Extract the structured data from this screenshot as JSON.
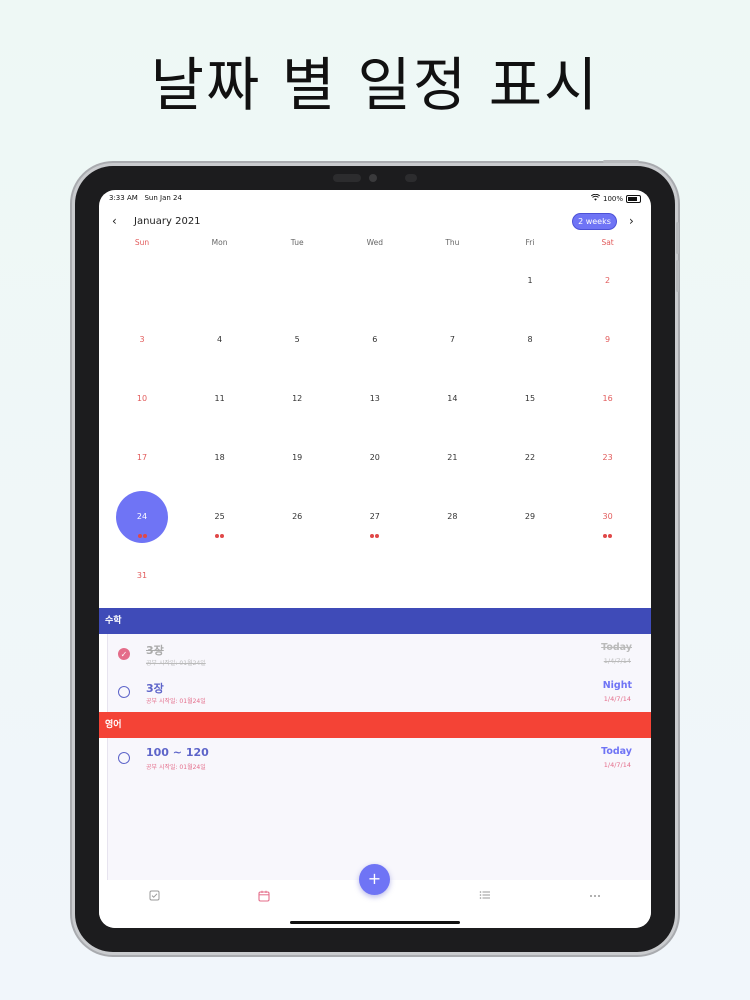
{
  "headline": "날짜 별 일정 표시",
  "status": {
    "time": "3:33 AM",
    "date": "Sun Jan 24",
    "battery": "100%"
  },
  "calendar": {
    "month": "January 2021",
    "view_toggle": "2 weeks",
    "weekdays": [
      "Sun",
      "Mon",
      "Tue",
      "Wed",
      "Thu",
      "Fri",
      "Sat"
    ],
    "weeks": [
      [
        "",
        "",
        "",
        "",
        "",
        "1",
        "2"
      ],
      [
        "3",
        "4",
        "5",
        "6",
        "7",
        "8",
        "9"
      ],
      [
        "10",
        "11",
        "12",
        "13",
        "14",
        "15",
        "16"
      ],
      [
        "17",
        "18",
        "19",
        "20",
        "21",
        "22",
        "23"
      ],
      [
        "24",
        "25",
        "26",
        "27",
        "28",
        "29",
        "30"
      ],
      [
        "31",
        "",
        "",
        "",
        "",
        "",
        ""
      ]
    ],
    "selected_day": "24",
    "days_with_events": [
      "24",
      "25",
      "27",
      "30"
    ],
    "accent_color": "#6f74f5",
    "weekend_color": "#e25c5c"
  },
  "sections": [
    {
      "name": "수학",
      "color": "#3f4bb8",
      "tasks": [
        {
          "title": "3장",
          "subtitle": "공부 시작일: 01월24일",
          "when": "Today",
          "date": "1/4/7/14",
          "done": true
        },
        {
          "title": "3장",
          "subtitle": "공부 시작일: 01월24일",
          "when": "Night",
          "date": "1/4/7/14",
          "done": false
        }
      ]
    },
    {
      "name": "영어",
      "color": "#f44336",
      "tasks": [
        {
          "title": "100 ~ 120",
          "subtitle": "공부 시작일: 01월24일",
          "when": "Today",
          "date": "1/4/7/14",
          "done": false
        }
      ]
    }
  ],
  "tabs": [
    {
      "icon": "checklist-icon",
      "glyph": "☑"
    },
    {
      "icon": "calendar-icon",
      "glyph": "▣"
    },
    {
      "icon": "list-icon",
      "glyph": "☰"
    },
    {
      "icon": "more-icon",
      "glyph": "···"
    }
  ],
  "fab_label": "+"
}
